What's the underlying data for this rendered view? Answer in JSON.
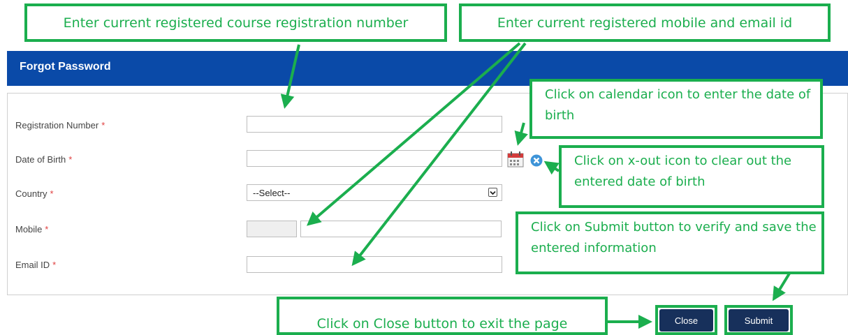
{
  "header": {
    "title": "Forgot Password"
  },
  "form": {
    "fields": [
      {
        "label": "Registration Number",
        "required_mark": "*"
      },
      {
        "label": "Date of Birth",
        "required_mark": "*"
      },
      {
        "label": "Country",
        "required_mark": "*"
      },
      {
        "label": "Mobile",
        "required_mark": "*"
      },
      {
        "label": "Email ID",
        "required_mark": "*"
      }
    ],
    "country_select": {
      "selected": "--Select--"
    },
    "icons": {
      "calendar": "calendar-icon",
      "clear": "x-out-icon"
    }
  },
  "buttons": {
    "close": "Close",
    "submit": "Submit"
  },
  "callouts": {
    "registration": "Enter current registered course registration number",
    "mobile_email": "Enter current registered mobile and email id",
    "calendar": "Click on calendar icon to enter the date of birth",
    "clear": "Click on x-out icon to clear out the entered date of birth",
    "submit": "Click on Submit button to verify and save the entered information",
    "close": "Click on Close button to exit the page"
  },
  "colors": {
    "header_bg": "#0a4aa8",
    "callout_green": "#1bae4e",
    "button_bg": "#17305b",
    "required_red": "#e04040"
  }
}
